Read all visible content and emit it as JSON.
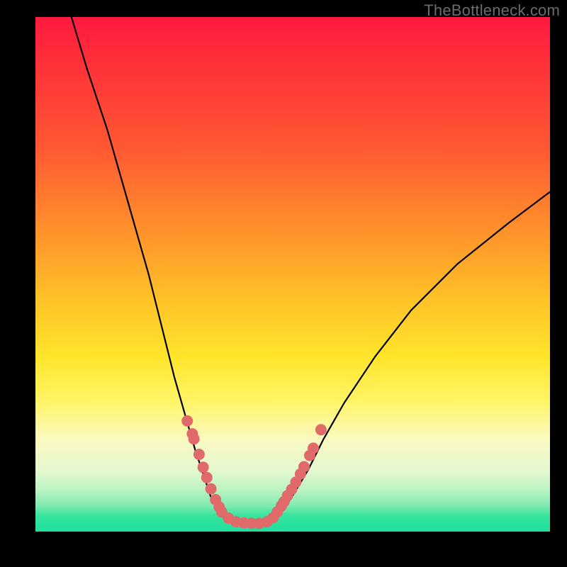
{
  "attribution": "TheBottleneck.com",
  "chart_data": {
    "type": "line",
    "title": "",
    "xlabel": "",
    "ylabel": "",
    "xlim": [
      0,
      100
    ],
    "ylim": [
      0,
      100
    ],
    "series": [
      {
        "name": "curve-left",
        "x": [
          7,
          10,
          14,
          18,
          22,
          25,
          27,
          29,
          31,
          33,
          34,
          35,
          36,
          37,
          38
        ],
        "y": [
          100,
          90,
          78,
          64,
          50,
          38,
          30,
          23,
          16,
          10,
          7,
          5,
          3.5,
          2.5,
          2
        ]
      },
      {
        "name": "curve-bottom",
        "x": [
          38,
          40,
          42,
          44,
          46
        ],
        "y": [
          2,
          1.5,
          1.5,
          1.5,
          2
        ]
      },
      {
        "name": "curve-right",
        "x": [
          46,
          48,
          50,
          53,
          56,
          60,
          66,
          73,
          82,
          92,
          100
        ],
        "y": [
          2,
          4,
          7,
          12,
          18,
          25,
          34,
          43,
          52,
          60,
          66
        ]
      }
    ],
    "scatter": {
      "name": "points",
      "color": "#e06a6a",
      "x": [
        29.5,
        30.5,
        30.8,
        31.8,
        32.6,
        33.3,
        34.1,
        35.0,
        35.7,
        36.2,
        37.5,
        39.0,
        40.5,
        42.0,
        43.5,
        45.0,
        46.2,
        47.0,
        47.8,
        48.3,
        49.0,
        49.8,
        50.6,
        51.5,
        52.2,
        53.3,
        54.0,
        55.5
      ],
      "y": [
        21.5,
        19.0,
        18.0,
        15.0,
        12.5,
        10.5,
        8.3,
        6.2,
        4.8,
        3.8,
        2.6,
        1.9,
        1.7,
        1.6,
        1.6,
        1.9,
        2.7,
        3.8,
        5.0,
        5.8,
        7.0,
        8.2,
        9.6,
        11.2,
        12.6,
        14.8,
        16.2,
        19.8
      ],
      "radius": 8
    },
    "gradient_bands": [
      {
        "pos": 0,
        "color": "#ff1a3f"
      },
      {
        "pos": 25,
        "color": "#ff5733"
      },
      {
        "pos": 55,
        "color": "#ffc228"
      },
      {
        "pos": 75,
        "color": "#fff56a"
      },
      {
        "pos": 92,
        "color": "#baf3c2"
      },
      {
        "pos": 100,
        "color": "#1ee0a0"
      }
    ]
  }
}
